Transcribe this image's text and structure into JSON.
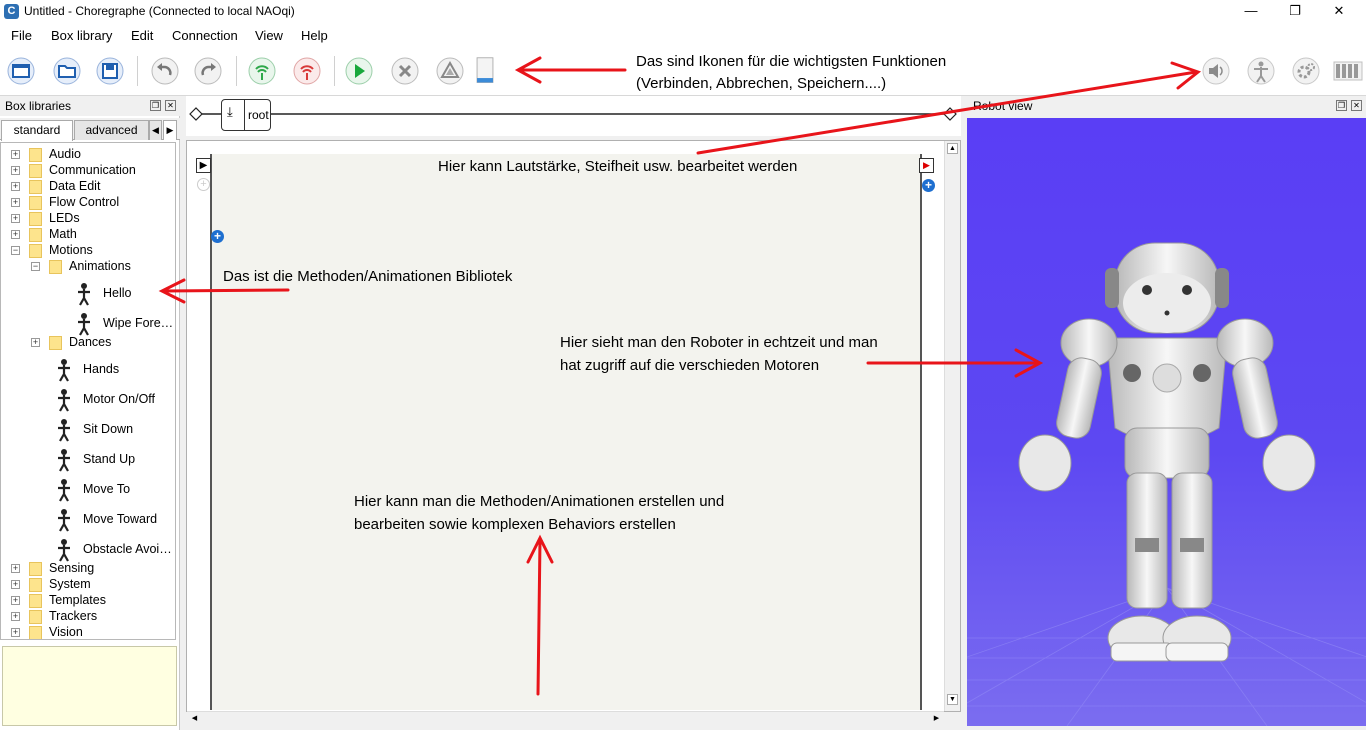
{
  "window": {
    "title": "Untitled - Choregraphe (Connected to local NAOqi)",
    "app_icon": "C",
    "minimize": "—",
    "maximize": "❐",
    "close": "✕"
  },
  "menu": [
    "File",
    "Box library",
    "Edit",
    "Connection",
    "View",
    "Help"
  ],
  "toolbar": {
    "icons": [
      "new-project-icon",
      "open-project-icon",
      "save-project-icon",
      "undo-icon",
      "redo-icon",
      "connect-icon",
      "disconnect-icon",
      "play-icon",
      "stop-icon",
      "debug-icon",
      "robot-state-icon",
      "volume-icon",
      "stiffness-icon",
      "settings-icon",
      "battery-icon"
    ]
  },
  "box_libraries": {
    "title": "Box libraries",
    "tabs": [
      "standard",
      "advanced"
    ],
    "tree": [
      {
        "label": "Audio",
        "type": "folder"
      },
      {
        "label": "Communication",
        "type": "folder"
      },
      {
        "label": "Data Edit",
        "type": "folder"
      },
      {
        "label": "Flow Control",
        "type": "folder"
      },
      {
        "label": "LEDs",
        "type": "folder"
      },
      {
        "label": "Math",
        "type": "folder"
      },
      {
        "label": "Motions",
        "type": "folder",
        "expanded": true
      },
      {
        "label": "Animations",
        "type": "folder",
        "expanded": true
      },
      {
        "label": "Hello",
        "type": "box"
      },
      {
        "label": "Wipe Fore…",
        "type": "box"
      },
      {
        "label": "Dances",
        "type": "folder"
      },
      {
        "label": "Hands",
        "type": "box"
      },
      {
        "label": "Motor On/Off",
        "type": "box"
      },
      {
        "label": "Sit Down",
        "type": "box"
      },
      {
        "label": "Stand Up",
        "type": "box"
      },
      {
        "label": "Move To",
        "type": "box"
      },
      {
        "label": "Move Toward",
        "type": "box"
      },
      {
        "label": "Obstacle Avoi…",
        "type": "box"
      },
      {
        "label": "Sensing",
        "type": "folder"
      },
      {
        "label": "System",
        "type": "folder"
      },
      {
        "label": "Templates",
        "type": "folder"
      },
      {
        "label": "Trackers",
        "type": "folder"
      },
      {
        "label": "Vision",
        "type": "folder"
      }
    ]
  },
  "diagram": {
    "root_label": "root"
  },
  "robot_view": {
    "title": "Robot view"
  },
  "annotations": {
    "toolbar_line1": "Das sind Ikonen für die wichtigsten Funktionen",
    "toolbar_line2": "(Verbinden, Abbrechen, Speichern....)",
    "volume": "Hier kann Lautstärke, Steifheit usw. bearbeitet werden",
    "library": "Das ist die Methoden/Animationen Bibliotek",
    "robot_line1": "Hier sieht man den Roboter in echtzeit und man",
    "robot_line2": "hat zugriff auf die verschieden Motoren",
    "editor_line1": "Hier kann man die Methoden/Animationen erstellen und",
    "editor_line2": "bearbeiten sowie komplexen Behaviors erstellen"
  },
  "colors": {
    "robot_background": "#5a3ef5",
    "annotation_arrow": "#e8141a",
    "connect_icon": "#2ea84a",
    "disconnect_icon": "#d83a3a",
    "play_icon": "#18a83c"
  }
}
